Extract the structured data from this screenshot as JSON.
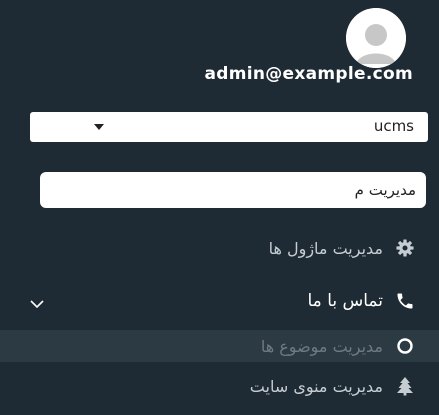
{
  "user": {
    "email": "admin@example.com"
  },
  "site_select": {
    "value": "ucms"
  },
  "search": {
    "value": "مدیریت م"
  },
  "menu": {
    "items": [
      {
        "label": "مدیریت ماژول ها",
        "icon": "gear-icon",
        "color": "#c5ccd2"
      },
      {
        "label": "تماس با ما",
        "icon": "phone-icon",
        "color": "#ffffff",
        "expanded": true
      },
      {
        "label": "مدیریت موضوع ها",
        "icon": "circle-icon",
        "color": "#6e7a84",
        "submenu": true
      },
      {
        "label": "مدیریت منوی سایت",
        "icon": "tree-icon",
        "color": "#c5ccd2"
      }
    ]
  },
  "colors": {
    "sidebar_bg": "#1f2b34",
    "submenu_bg": "#2c3a44",
    "text_primary": "#ffffff"
  }
}
